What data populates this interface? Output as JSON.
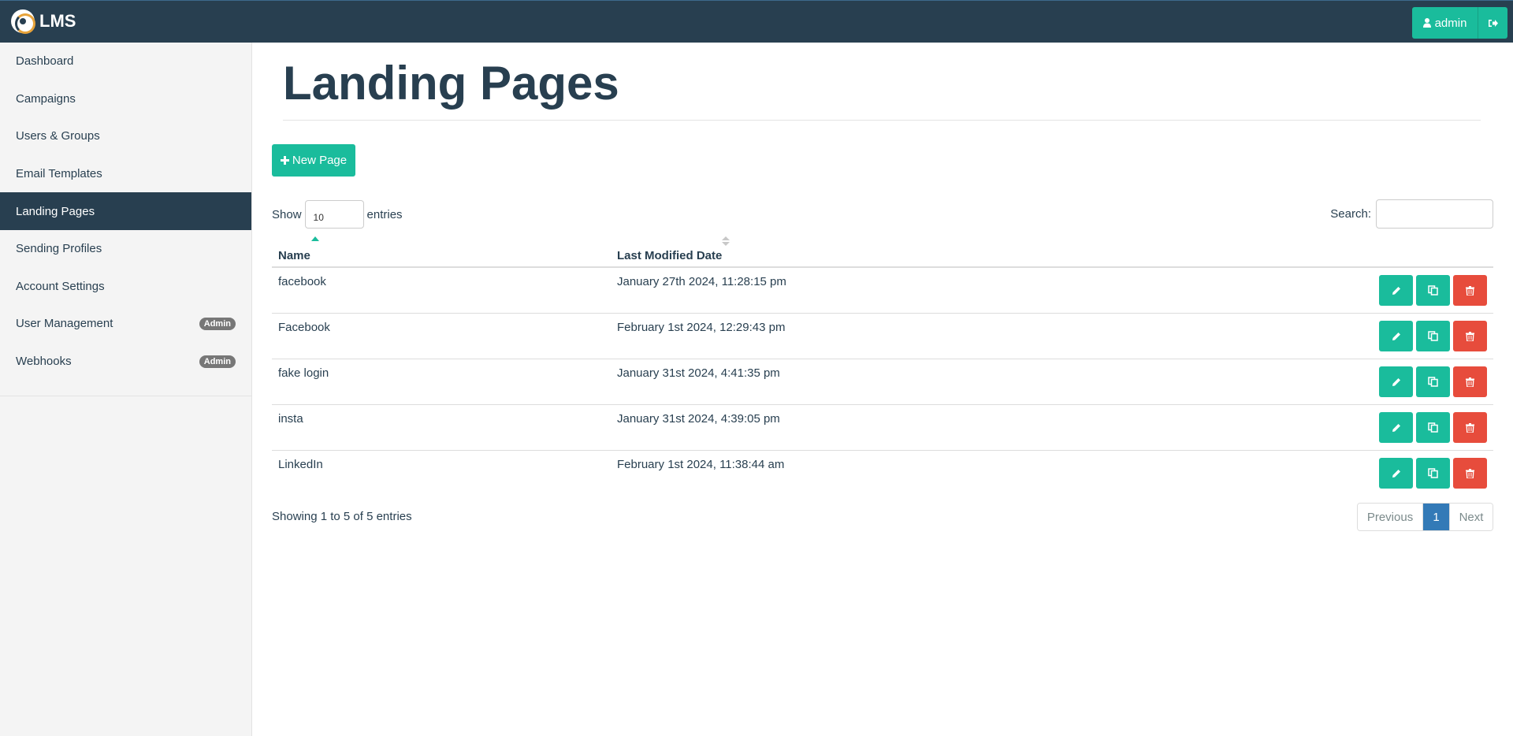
{
  "navbar": {
    "brand": "LMS",
    "user_label": "admin",
    "icons": {
      "user": "user-icon",
      "logout": "sign-out-icon"
    }
  },
  "sidebar": {
    "items": [
      {
        "label": "Dashboard",
        "badge": "",
        "active": false
      },
      {
        "label": "Campaigns",
        "badge": "",
        "active": false
      },
      {
        "label": "Users & Groups",
        "badge": "",
        "active": false
      },
      {
        "label": "Email Templates",
        "badge": "",
        "active": false
      },
      {
        "label": "Landing Pages",
        "badge": "",
        "active": true
      },
      {
        "label": "Sending Profiles",
        "badge": "",
        "active": false
      },
      {
        "label": "Account Settings",
        "badge": "",
        "active": false
      },
      {
        "label": "User Management",
        "badge": "Admin",
        "active": false
      },
      {
        "label": "Webhooks",
        "badge": "Admin",
        "active": false
      }
    ]
  },
  "main": {
    "title": "Landing Pages",
    "new_button_label": "New Page",
    "length": {
      "show_label": "Show",
      "value": "10",
      "entries_label": "entries"
    },
    "search": {
      "label": "Search:",
      "value": ""
    },
    "table": {
      "columns": [
        "Name",
        "Last Modified Date"
      ],
      "sort": {
        "column": "Name",
        "direction": "asc"
      },
      "rows": [
        {
          "name": "facebook",
          "modified": "January 27th 2024, 11:28:15 pm"
        },
        {
          "name": "Facebook",
          "modified": "February 1st 2024, 12:29:43 pm"
        },
        {
          "name": "fake login",
          "modified": "January 31st 2024, 4:41:35 pm"
        },
        {
          "name": "insta",
          "modified": "January 31st 2024, 4:39:05 pm"
        },
        {
          "name": "LinkedIn",
          "modified": "February 1st 2024, 11:38:44 am"
        }
      ]
    },
    "info": "Showing 1 to 5 of 5 entries",
    "pagination": {
      "previous": "Previous",
      "current": "1",
      "next": "Next"
    }
  },
  "colors": {
    "navbar_bg": "#283f50",
    "accent": "#1abc9c",
    "danger": "#e74c3c",
    "page_active": "#337ab7",
    "sidebar_bg": "#f4f4f4"
  }
}
